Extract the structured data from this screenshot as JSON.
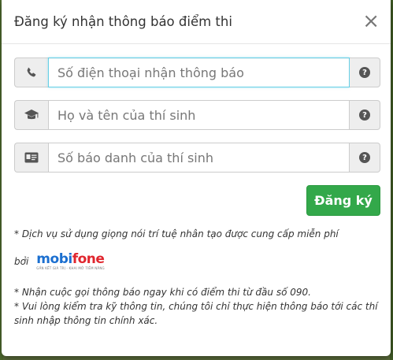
{
  "modal": {
    "title": "Đăng ký nhận thông báo điểm thi",
    "close_glyph": "×"
  },
  "form": {
    "phone": {
      "placeholder": "Số điện thoại nhận thông báo",
      "icon": "phone-icon"
    },
    "name": {
      "placeholder": "Họ và tên của thí sinh",
      "icon": "graduation-cap-icon"
    },
    "id_number": {
      "placeholder": "Số báo danh của thí sinh",
      "icon": "id-card-icon"
    },
    "help_glyph": "?",
    "submit_label": "Đăng ký"
  },
  "notes": {
    "ai_voice": "* Dịch vụ sử dụng giọng nói trí tuệ nhân tạo được cung cấp miễn phí",
    "provider_prefix": "bởi",
    "provider_logo_part1": "mobi",
    "provider_logo_part2": "fone",
    "provider_tagline": "GẮN KẾT GIÁ TRỊ - KHAI MỞ TIỀM NĂNG",
    "call_note": "* Nhận cuộc gọi thông báo ngay khi có điểm thi từ đầu số 090.",
    "verify_note": "* Vui lòng kiểm tra kỹ thông tin, chúng tôi chỉ thực hiện thông báo tới các thí sinh nhập thông tin chính xác."
  },
  "colors": {
    "submit_bg": "#33a84a",
    "focus_border": "#66cfe6",
    "logo_blue": "#1b6fd0",
    "logo_red": "#e0262e"
  }
}
